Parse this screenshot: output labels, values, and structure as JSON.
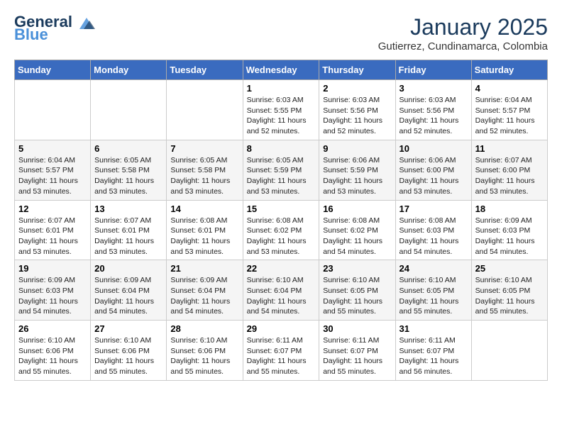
{
  "header": {
    "logo_line1": "General",
    "logo_line2": "Blue",
    "month": "January 2025",
    "location": "Gutierrez, Cundinamarca, Colombia"
  },
  "weekdays": [
    "Sunday",
    "Monday",
    "Tuesday",
    "Wednesday",
    "Thursday",
    "Friday",
    "Saturday"
  ],
  "weeks": [
    [
      {
        "day": "",
        "sunrise": "",
        "sunset": "",
        "daylight": ""
      },
      {
        "day": "",
        "sunrise": "",
        "sunset": "",
        "daylight": ""
      },
      {
        "day": "",
        "sunrise": "",
        "sunset": "",
        "daylight": ""
      },
      {
        "day": "1",
        "sunrise": "Sunrise: 6:03 AM",
        "sunset": "Sunset: 5:55 PM",
        "daylight": "Daylight: 11 hours and 52 minutes."
      },
      {
        "day": "2",
        "sunrise": "Sunrise: 6:03 AM",
        "sunset": "Sunset: 5:56 PM",
        "daylight": "Daylight: 11 hours and 52 minutes."
      },
      {
        "day": "3",
        "sunrise": "Sunrise: 6:03 AM",
        "sunset": "Sunset: 5:56 PM",
        "daylight": "Daylight: 11 hours and 52 minutes."
      },
      {
        "day": "4",
        "sunrise": "Sunrise: 6:04 AM",
        "sunset": "Sunset: 5:57 PM",
        "daylight": "Daylight: 11 hours and 52 minutes."
      }
    ],
    [
      {
        "day": "5",
        "sunrise": "Sunrise: 6:04 AM",
        "sunset": "Sunset: 5:57 PM",
        "daylight": "Daylight: 11 hours and 53 minutes."
      },
      {
        "day": "6",
        "sunrise": "Sunrise: 6:05 AM",
        "sunset": "Sunset: 5:58 PM",
        "daylight": "Daylight: 11 hours and 53 minutes."
      },
      {
        "day": "7",
        "sunrise": "Sunrise: 6:05 AM",
        "sunset": "Sunset: 5:58 PM",
        "daylight": "Daylight: 11 hours and 53 minutes."
      },
      {
        "day": "8",
        "sunrise": "Sunrise: 6:05 AM",
        "sunset": "Sunset: 5:59 PM",
        "daylight": "Daylight: 11 hours and 53 minutes."
      },
      {
        "day": "9",
        "sunrise": "Sunrise: 6:06 AM",
        "sunset": "Sunset: 5:59 PM",
        "daylight": "Daylight: 11 hours and 53 minutes."
      },
      {
        "day": "10",
        "sunrise": "Sunrise: 6:06 AM",
        "sunset": "Sunset: 6:00 PM",
        "daylight": "Daylight: 11 hours and 53 minutes."
      },
      {
        "day": "11",
        "sunrise": "Sunrise: 6:07 AM",
        "sunset": "Sunset: 6:00 PM",
        "daylight": "Daylight: 11 hours and 53 minutes."
      }
    ],
    [
      {
        "day": "12",
        "sunrise": "Sunrise: 6:07 AM",
        "sunset": "Sunset: 6:01 PM",
        "daylight": "Daylight: 11 hours and 53 minutes."
      },
      {
        "day": "13",
        "sunrise": "Sunrise: 6:07 AM",
        "sunset": "Sunset: 6:01 PM",
        "daylight": "Daylight: 11 hours and 53 minutes."
      },
      {
        "day": "14",
        "sunrise": "Sunrise: 6:08 AM",
        "sunset": "Sunset: 6:01 PM",
        "daylight": "Daylight: 11 hours and 53 minutes."
      },
      {
        "day": "15",
        "sunrise": "Sunrise: 6:08 AM",
        "sunset": "Sunset: 6:02 PM",
        "daylight": "Daylight: 11 hours and 53 minutes."
      },
      {
        "day": "16",
        "sunrise": "Sunrise: 6:08 AM",
        "sunset": "Sunset: 6:02 PM",
        "daylight": "Daylight: 11 hours and 54 minutes."
      },
      {
        "day": "17",
        "sunrise": "Sunrise: 6:08 AM",
        "sunset": "Sunset: 6:03 PM",
        "daylight": "Daylight: 11 hours and 54 minutes."
      },
      {
        "day": "18",
        "sunrise": "Sunrise: 6:09 AM",
        "sunset": "Sunset: 6:03 PM",
        "daylight": "Daylight: 11 hours and 54 minutes."
      }
    ],
    [
      {
        "day": "19",
        "sunrise": "Sunrise: 6:09 AM",
        "sunset": "Sunset: 6:03 PM",
        "daylight": "Daylight: 11 hours and 54 minutes."
      },
      {
        "day": "20",
        "sunrise": "Sunrise: 6:09 AM",
        "sunset": "Sunset: 6:04 PM",
        "daylight": "Daylight: 11 hours and 54 minutes."
      },
      {
        "day": "21",
        "sunrise": "Sunrise: 6:09 AM",
        "sunset": "Sunset: 6:04 PM",
        "daylight": "Daylight: 11 hours and 54 minutes."
      },
      {
        "day": "22",
        "sunrise": "Sunrise: 6:10 AM",
        "sunset": "Sunset: 6:04 PM",
        "daylight": "Daylight: 11 hours and 54 minutes."
      },
      {
        "day": "23",
        "sunrise": "Sunrise: 6:10 AM",
        "sunset": "Sunset: 6:05 PM",
        "daylight": "Daylight: 11 hours and 55 minutes."
      },
      {
        "day": "24",
        "sunrise": "Sunrise: 6:10 AM",
        "sunset": "Sunset: 6:05 PM",
        "daylight": "Daylight: 11 hours and 55 minutes."
      },
      {
        "day": "25",
        "sunrise": "Sunrise: 6:10 AM",
        "sunset": "Sunset: 6:05 PM",
        "daylight": "Daylight: 11 hours and 55 minutes."
      }
    ],
    [
      {
        "day": "26",
        "sunrise": "Sunrise: 6:10 AM",
        "sunset": "Sunset: 6:06 PM",
        "daylight": "Daylight: 11 hours and 55 minutes."
      },
      {
        "day": "27",
        "sunrise": "Sunrise: 6:10 AM",
        "sunset": "Sunset: 6:06 PM",
        "daylight": "Daylight: 11 hours and 55 minutes."
      },
      {
        "day": "28",
        "sunrise": "Sunrise: 6:10 AM",
        "sunset": "Sunset: 6:06 PM",
        "daylight": "Daylight: 11 hours and 55 minutes."
      },
      {
        "day": "29",
        "sunrise": "Sunrise: 6:11 AM",
        "sunset": "Sunset: 6:07 PM",
        "daylight": "Daylight: 11 hours and 55 minutes."
      },
      {
        "day": "30",
        "sunrise": "Sunrise: 6:11 AM",
        "sunset": "Sunset: 6:07 PM",
        "daylight": "Daylight: 11 hours and 55 minutes."
      },
      {
        "day": "31",
        "sunrise": "Sunrise: 6:11 AM",
        "sunset": "Sunset: 6:07 PM",
        "daylight": "Daylight: 11 hours and 56 minutes."
      },
      {
        "day": "",
        "sunrise": "",
        "sunset": "",
        "daylight": ""
      }
    ]
  ]
}
